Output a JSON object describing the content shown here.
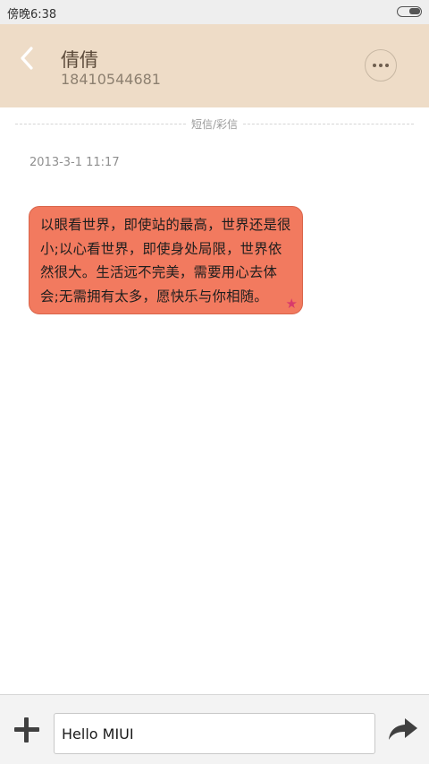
{
  "status_bar": {
    "time": "傍晚6:38"
  },
  "header": {
    "back_icon": "chevron-left-icon",
    "contact_name": "倩倩",
    "contact_number": "18410544681",
    "more_icon": "more-dots-icon"
  },
  "conversation": {
    "divider_label": "短信/彩信",
    "timestamp": "2013-3-1 11:17",
    "messages": [
      {
        "text": "以眼看世界，即使站的最高，世界还是很小;以心看世界，即使身处局限，世界依然很大。生活远不完美，需要用心去体会;无需拥有太多，愿快乐与你相随。",
        "bubble_color": "#f27a5f",
        "starred": true,
        "star_icon": "star-icon"
      }
    ]
  },
  "composer": {
    "add_icon": "plus-icon",
    "input_value": "Hello MIUI",
    "send_icon": "send-arrow-icon"
  },
  "colors": {
    "header_bg": "#eedcc7",
    "status_bar_bg": "#eeeeee",
    "bubble": "#f27a5f",
    "star": "#d83a6b"
  }
}
